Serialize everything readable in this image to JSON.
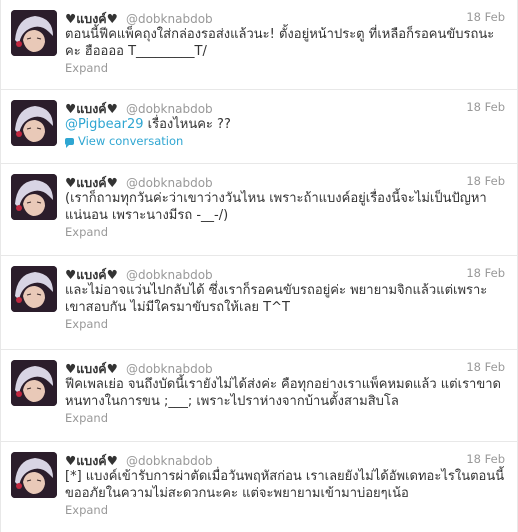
{
  "tweets": [
    {
      "name": "♥แบงค์♥",
      "handle": "@dobknabdob",
      "date": "18 Feb",
      "text": "ตอนนี้ฟีคแพ็คถุงใส่กล่องรอส่งแล้วนะ! ตั้งอยู่หน้าประตู ที่เหลือก็รอคนขับรถนะคะ ฮืออออ T_________T/",
      "footer": "Expand"
    },
    {
      "name": "♥แบงค์♥",
      "handle": "@dobknabdob",
      "date": "18 Feb",
      "mention": "@Pigbear29",
      "text": " เรื่องไหนคะ ??",
      "footer": "View conversation",
      "footer_icon": "conversation-bubble-icon"
    },
    {
      "name": "♥แบงค์♥",
      "handle": "@dobknabdob",
      "date": "18 Feb",
      "text": "(เราก็ถามทุกวันค่ะว่าเขาว่างวันไหน เพราะถ้าแบงค์อยู่เรื่องนี้จะไม่เป็นปัญหาแน่นอน เพราะนางมีรถ -__-/)",
      "footer": "Expand"
    },
    {
      "name": "♥แบงค์♥",
      "handle": "@dobknabdob",
      "date": "18 Feb",
      "text": "และไม่อาจแว่นไปกลับได้ ซึ่งเราก็รอคนขับรถอยู่ค่ะ พยายามจิกแล้วแต่เพราะเขาสอบกัน ไม่มีใครมาขับรถให้เลย T^T",
      "footer": "Expand"
    },
    {
      "name": "♥แบงค์♥",
      "handle": "@dobknabdob",
      "date": "18 Feb",
      "text": "ฟีคเพลเย่อ จนถึงบัดนี้เรายังไม่ได้ส่งค่ะ คือทุกอย่างเราแพ็คหมดแล้ว แต่เราขาดหนทางในการขน ;___; เพราะไปราห่างจากบ้านตั้งสามสิบโล",
      "footer": "Expand"
    },
    {
      "name": "♥แบงค์♥",
      "handle": "@dobknabdob",
      "date": "18 Feb",
      "text": "[*] แบงค์เข้ารับการผ่าตัดเมื่อวันพฤหัสก่อน เราเลยยังไม่ได้อัพเดทอะไรในตอนนี้ ขออภัยในความไม่สะดวกนะคะ แต่จะพยายามเข้ามาบ่อยๆเน้อ",
      "footer": "Expand"
    }
  ],
  "colors": {
    "link": "#2fa6d2",
    "muted": "#999999",
    "text": "#333333",
    "divider": "#e8e8e8"
  }
}
